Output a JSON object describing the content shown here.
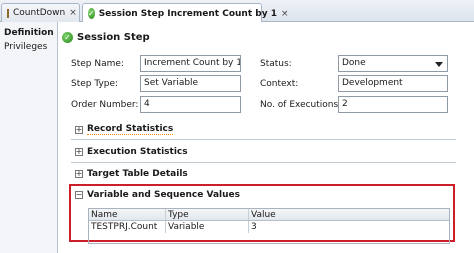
{
  "tabs": [
    {
      "label": "CountDown",
      "icon": "grid-icon",
      "active": false
    },
    {
      "label": "Session Step Increment Count by 1",
      "icon": "check-circle-icon",
      "active": true
    }
  ],
  "left_nav": {
    "items": [
      {
        "label": "Definition",
        "selected": true
      },
      {
        "label": "Privileges",
        "selected": false
      }
    ]
  },
  "section": {
    "title": "Session Step"
  },
  "form": {
    "step_name_label": "Step Name:",
    "step_name_value": "Increment Count by 1",
    "step_type_label": "Step Type:",
    "step_type_value": "Set Variable",
    "order_number_label": "Order Number:",
    "order_number_value": "4",
    "status_label": "Status:",
    "status_value": "Done",
    "context_label": "Context:",
    "context_value": "Development",
    "executions_label": "No. of Executions:",
    "executions_value": "2"
  },
  "collapsibles": [
    {
      "title": "Record Statistics",
      "expanded": false
    },
    {
      "title": "Execution Statistics",
      "expanded": false
    },
    {
      "title": "Target Table Details",
      "expanded": false
    },
    {
      "title": "Variable and Sequence Values",
      "expanded": true
    }
  ],
  "variables_table": {
    "columns": [
      "Name",
      "Type",
      "Value"
    ],
    "rows": [
      [
        "TESTPRJ.Count",
        "Variable",
        "3"
      ]
    ]
  },
  "colors": {
    "highlight": "#cc1f2a",
    "ok_green": "#2a8a1a"
  }
}
